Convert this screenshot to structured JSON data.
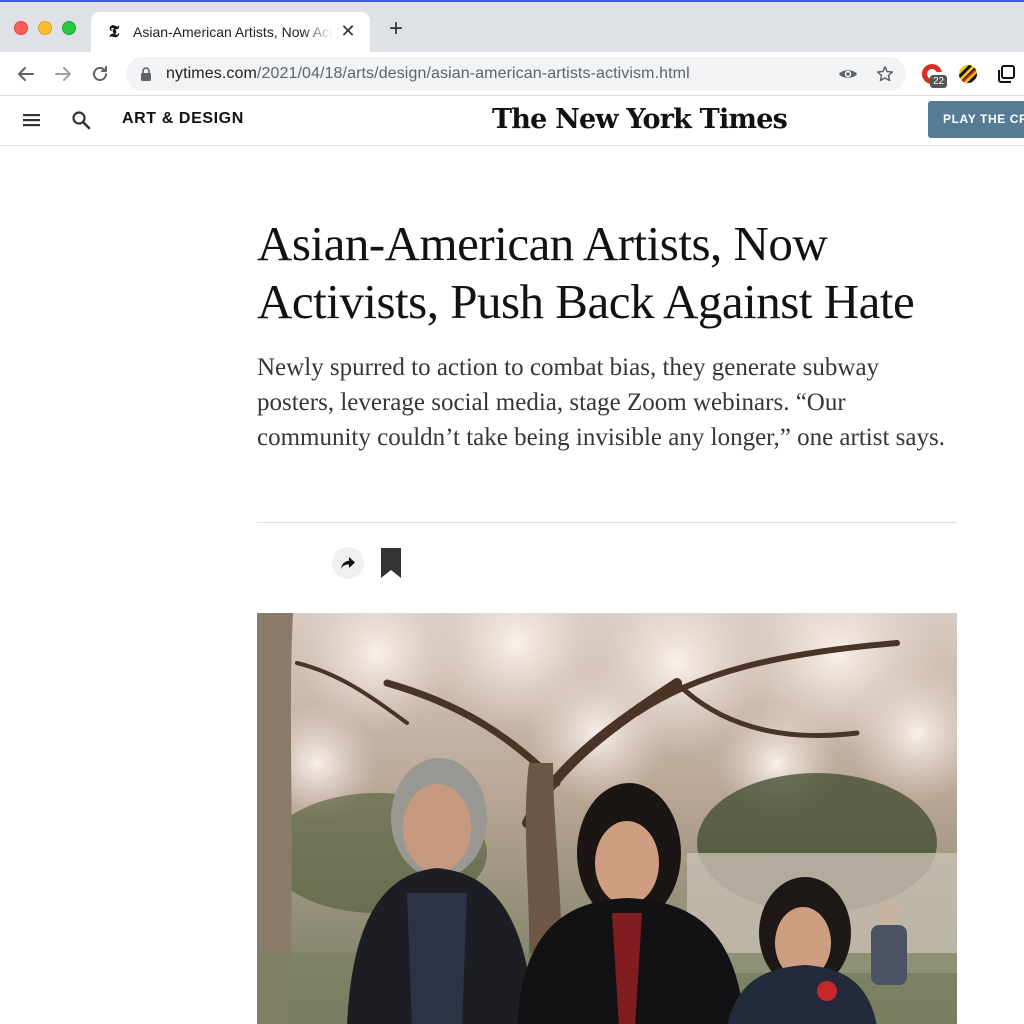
{
  "browser": {
    "tab": {
      "favicon_glyph": "𝕿",
      "title": "Asian-American Artists, Now Activists, Push Back Against Hate"
    },
    "new_tab_glyph": "+",
    "close_glyph": "✕",
    "url": {
      "host": "nytimes.com",
      "path": "/2021/04/18/arts/design/asian-american-artists-activism.html"
    },
    "extension_badge": "22"
  },
  "header": {
    "section": "ART & DESIGN",
    "masthead": "The New York Times",
    "cta_label": "PLAY THE CR"
  },
  "article": {
    "headline": "Asian-American Artists, Now Activists, Push Back Against Hate",
    "summary": "Newly spurred to action to combat bias, they generate subway posters, leverage social media, stage Zoom webinars. “Our community couldn’t take being invisible any longer,” one artist says."
  },
  "colors": {
    "tabstrip": "#dee1e6",
    "cta": "#567b95",
    "text": "#121212"
  },
  "icons": [
    "nyt-favicon-icon",
    "close-icon",
    "plus-icon",
    "back-arrow-icon",
    "forward-arrow-icon",
    "reload-icon",
    "lock-icon",
    "eye-icon",
    "star-icon",
    "extension-icon",
    "extension-striped-icon",
    "tabs-icon",
    "hamburger-menu-icon",
    "search-icon",
    "share-icon",
    "bookmark-icon"
  ]
}
